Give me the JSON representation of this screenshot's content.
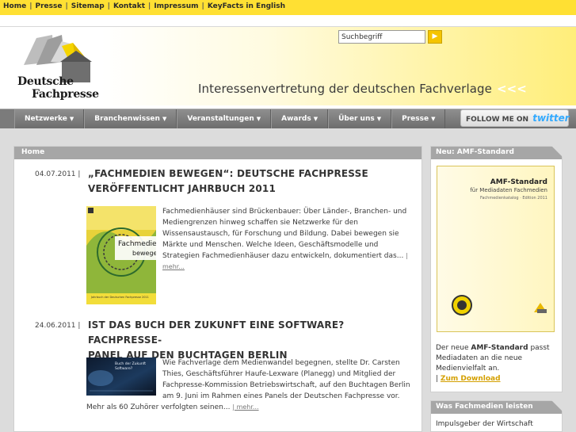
{
  "topnav": {
    "items": [
      "Home",
      "Presse",
      "Sitemap",
      "Kontakt",
      "Impressum",
      "KeyFacts in English"
    ]
  },
  "header": {
    "logo_line1": "Deutsche",
    "logo_line2": "Fachpresse",
    "tagline": "Interessenvertretung der deutschen Fachverlage",
    "tagline_arrows": "<<<",
    "search_value": "Suchbegriff"
  },
  "mainnav": {
    "items": [
      "Netzwerke",
      "Branchenwissen",
      "Veranstaltungen",
      "Awards",
      "Über uns",
      "Presse"
    ],
    "follow_label": "FOLLOW ME ON",
    "follow_brand": "twitter"
  },
  "content": {
    "breadcrumb": "Home",
    "articles": [
      {
        "date": "04.07.2011 |",
        "title_l1": "„FACHMEDIEN BEWEGEN“: DEUTSCHE FACHPRESSE",
        "title_l2": "VERÖFFENTLICHT JAHRBUCH 2011",
        "body": "Fachmedienhäuser sind Brückenbauer: Über Länder-, Branchen- und Mediengrenzen hinweg schaffen sie Netzwerke für den Wissensaustausch, für Forschung und Bildung. Dabei bewegen sie Märkte und Menschen. Welche Ideen, Geschäftsmodelle und Strategien Fachmedienhäuser dazu entwickeln, dokumentiert das...",
        "more": "| mehr...",
        "thumb_title_l1": "Fachmedien",
        "thumb_title_l2": "bewegen",
        "thumb_caption": "Jahrbuch der Deutschen Fachpresse 2011"
      },
      {
        "date": "24.06.2011 |",
        "title_l1": "IST DAS BUCH DER ZUKUNFT EINE SOFTWARE? FACHPRESSE-",
        "title_l2": "PANEL AUF DEN BUCHTAGEN BERLIN",
        "body_l1": "Wie Fachverlage dem Medienwandel begegnen, stellte Dr. Carsten",
        "body_l2": "Thies, Geschäftsführer Haufe-Lexware (Planegg) und Mitglied der",
        "body_l3": "Fachpresse-Kommission Betriebswirtschaft, auf den Buchtagen Berlin",
        "body_l4": "am 9. Juni im Rahmen eines Panels der Deutschen Fachpresse vor.",
        "body_l5": "Mehr als 60 Zuhörer verfolgten seinen...",
        "more": "| mehr...",
        "thumb_title": "Buch der Zukunft Software?"
      }
    ]
  },
  "sidebar": {
    "box1_title": "Neu: AMF-Standard",
    "cover_title": "AMF-Standard",
    "cover_sub": "für Mediadaten Fachmedien",
    "cover_small": "Fachmedienkatalog · Edition 2011",
    "text_pre": "Der neue ",
    "text_bold": "AMF-Standard",
    "text_post": " passt Mediadaten an die neue Medienvielfalt an.",
    "link_sep": "|",
    "link_label": "Zum Download",
    "box2_title": "Was Fachmedien leisten",
    "box2_text": "Impulsgeber der Wirtschaft"
  },
  "colors": {
    "accent_yellow": "#ffe033",
    "nav_grey": "#7b7b7b",
    "panel_head_grey": "#a6a6a6",
    "twitter_blue": "#33aaff"
  }
}
